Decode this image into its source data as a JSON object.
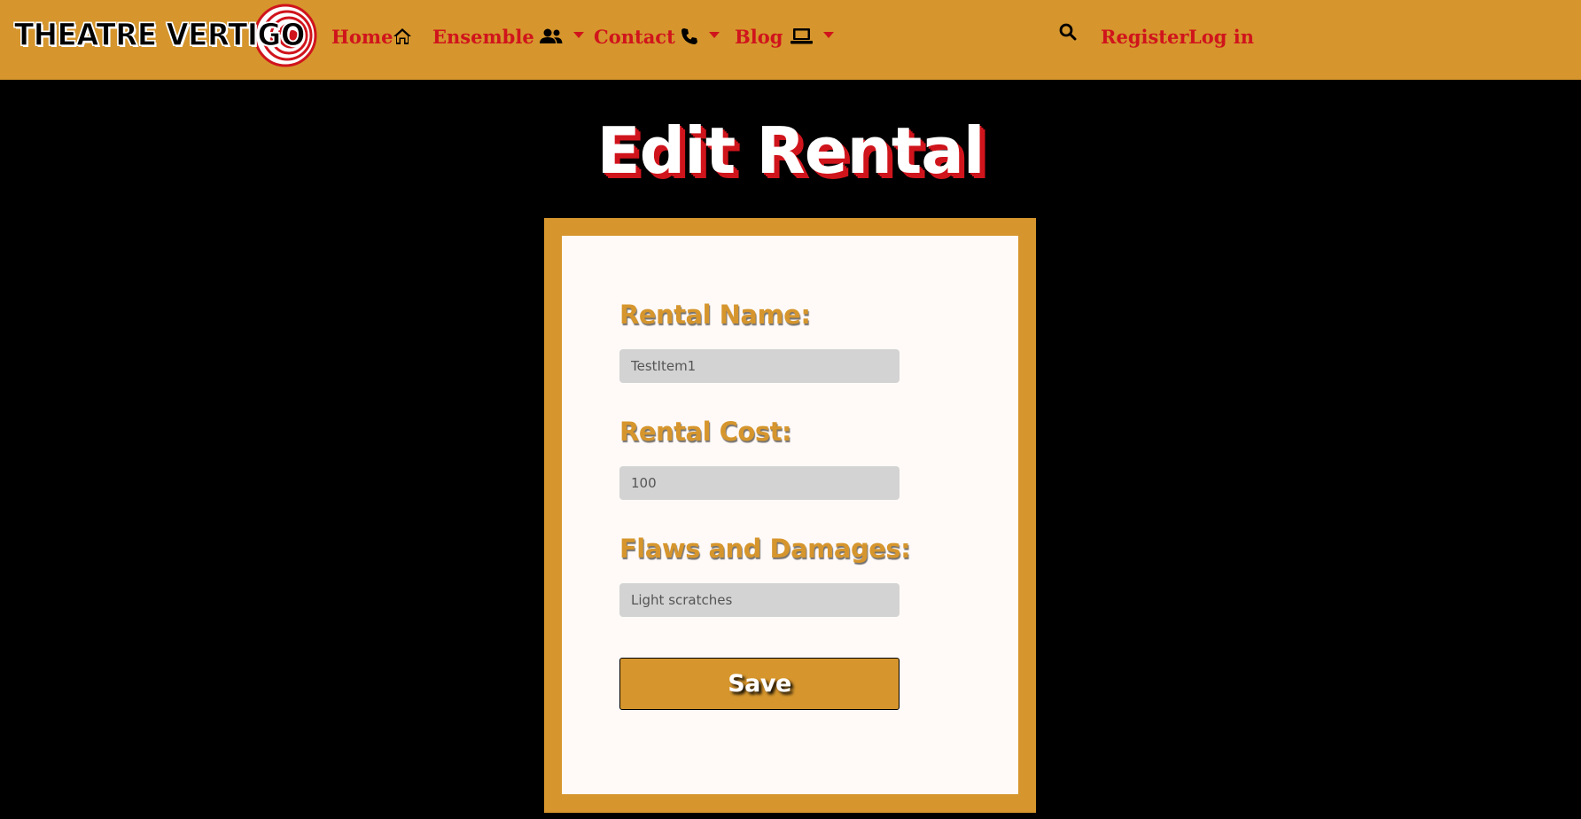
{
  "brand": {
    "logo_text": "THEATRE VERTIGO"
  },
  "nav": {
    "home_label": "Home",
    "ensemble_label": "Ensemble",
    "contact_label": "Contact",
    "blog_label": "Blog",
    "register_label": "Register",
    "login_label": "Log in"
  },
  "icons": {
    "home": "home-icon",
    "ensemble": "users-icon",
    "contact": "phone-icon",
    "blog": "laptop-icon",
    "search": "search-icon"
  },
  "page": {
    "title": "Edit Rental"
  },
  "form": {
    "name_label": "Rental Name:",
    "name_value": "TestItem1",
    "cost_label": "Rental Cost:",
    "cost_value": "100",
    "flaws_label": "Flaws and Damages:",
    "flaws_value": "Light scratches",
    "save_label": "Save"
  },
  "colors": {
    "navbar": "#d6962d",
    "nav_link": "#d0141c",
    "background": "#000000",
    "card_border": "#d6962d",
    "card_bg": "#fffaf8",
    "input_bg": "#d3d3d3"
  }
}
